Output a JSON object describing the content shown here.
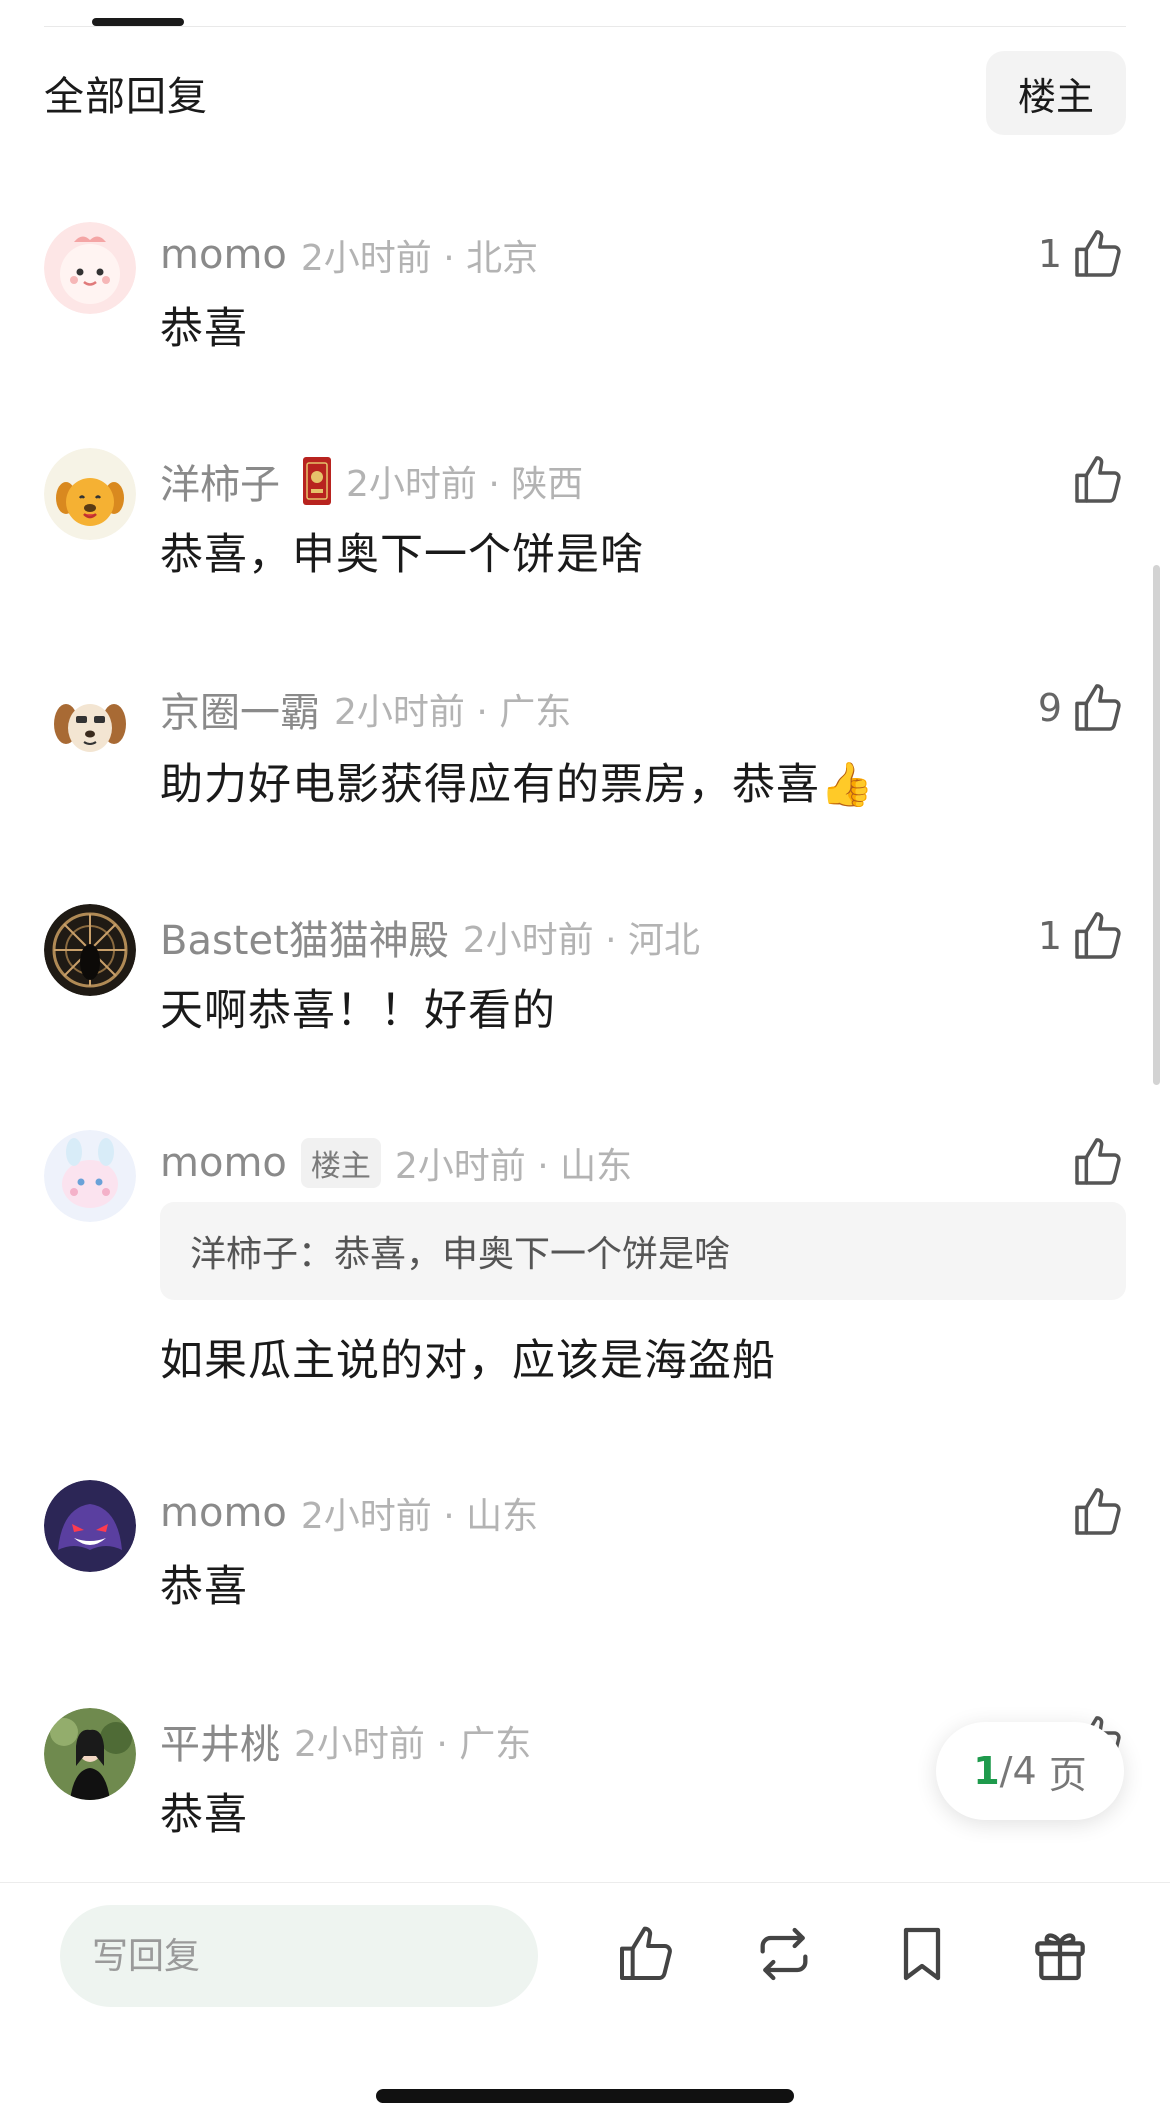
{
  "header": {
    "title": "全部回复",
    "op_filter": "楼主"
  },
  "comments": [
    {
      "name": "momo",
      "time": "2小时前",
      "location": "北京",
      "text": "恭喜",
      "likes": "1",
      "avatar": "pink-blob-avatar"
    },
    {
      "name": "洋柿子",
      "time": "2小时前",
      "location": "陕西",
      "text": "恭喜，申奥下一个饼是啥",
      "likes": "",
      "avatar": "yellow-dog-avatar",
      "badge": "red-medal-badge"
    },
    {
      "name": "京圈一霸",
      "time": "2小时前",
      "location": "广东",
      "text": "助力好电影获得应有的票房，恭喜👍",
      "likes": "9",
      "avatar": "beagle-avatar"
    },
    {
      "name": "Bastet猫猫神殿",
      "time": "2小时前",
      "location": "河北",
      "text": "天啊恭喜！！好看的",
      "likes": "1",
      "avatar": "temple-avatar"
    },
    {
      "name": "momo",
      "op_tag": "楼主",
      "time": "2小时前",
      "location": "山东",
      "quote": "洋柿子：恭喜，申奥下一个饼是啥",
      "text": "如果瓜主说的对，应该是海盗船",
      "likes": "",
      "avatar": "pastel-bunny-avatar"
    },
    {
      "name": "momo",
      "time": "2小时前",
      "location": "山东",
      "text": "恭喜",
      "likes": "",
      "avatar": "purple-ghost-avatar"
    },
    {
      "name": "平井桃",
      "time": "2小时前",
      "location": "广东",
      "text": "恭喜",
      "likes": "",
      "avatar": "photo-avatar"
    }
  ],
  "meta_separator": "·",
  "pagination": {
    "current": "1",
    "separator": "/",
    "total": "4",
    "unit": "页"
  },
  "bottom_bar": {
    "reply_placeholder": "写回复"
  },
  "colors": {
    "accent_green": "#1e9a4c",
    "meta_grey": "#b3b3b3"
  }
}
